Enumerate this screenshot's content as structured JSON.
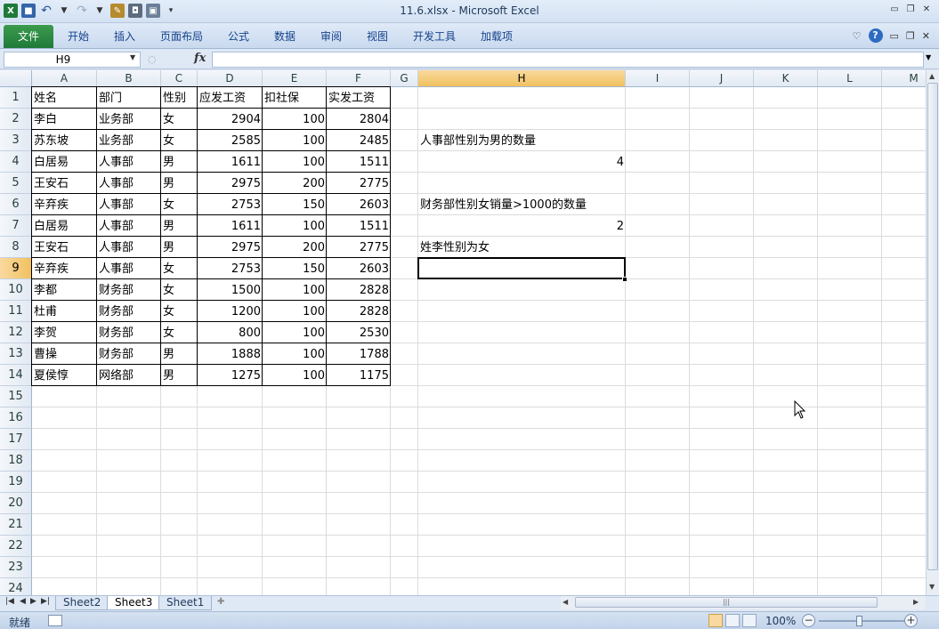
{
  "window": {
    "title": "11.6.xlsx - Microsoft Excel"
  },
  "ribbon": {
    "file_tab": "文件",
    "tabs": [
      "开始",
      "插入",
      "页面布局",
      "公式",
      "数据",
      "审阅",
      "视图",
      "开发工具",
      "加载项"
    ]
  },
  "formula_bar": {
    "name_box": "H9",
    "fx_label": "fx",
    "content": ""
  },
  "grid": {
    "columns": [
      "A",
      "B",
      "C",
      "D",
      "E",
      "F",
      "G",
      "H",
      "I",
      "J",
      "K",
      "L",
      "M"
    ],
    "selected_column": "H",
    "rows": [
      "1",
      "2",
      "3",
      "4",
      "5",
      "6",
      "7",
      "8",
      "9",
      "10",
      "11",
      "12",
      "13",
      "14",
      "15",
      "16",
      "17",
      "18",
      "19",
      "20",
      "21",
      "22",
      "23",
      "24"
    ],
    "selected_row": "9",
    "active_cell": "H9",
    "table": {
      "headers": [
        "姓名",
        "部门",
        "性别",
        "应发工资",
        "扣社保",
        "实发工资"
      ],
      "records": [
        [
          "李白",
          "业务部",
          "女",
          "2904",
          "100",
          "2804"
        ],
        [
          "苏东坡",
          "业务部",
          "女",
          "2585",
          "100",
          "2485"
        ],
        [
          "白居易",
          "人事部",
          "男",
          "1611",
          "100",
          "1511"
        ],
        [
          "王安石",
          "人事部",
          "男",
          "2975",
          "200",
          "2775"
        ],
        [
          "辛弃疾",
          "人事部",
          "女",
          "2753",
          "150",
          "2603"
        ],
        [
          "白居易",
          "人事部",
          "男",
          "1611",
          "100",
          "1511"
        ],
        [
          "王安石",
          "人事部",
          "男",
          "2975",
          "200",
          "2775"
        ],
        [
          "辛弃疾",
          "人事部",
          "女",
          "2753",
          "150",
          "2603"
        ],
        [
          "李都",
          "财务部",
          "女",
          "1500",
          "100",
          "2828"
        ],
        [
          "杜甫",
          "财务部",
          "女",
          "1200",
          "100",
          "2828"
        ],
        [
          "李贺",
          "财务部",
          "女",
          "800",
          "100",
          "2530"
        ],
        [
          "曹操",
          "财务部",
          "男",
          "1888",
          "100",
          "1788"
        ],
        [
          "夏侯惇",
          "网络部",
          "男",
          "1275",
          "100",
          "1175"
        ]
      ]
    },
    "h_column": {
      "h3": "人事部性别为男的数量",
      "h4": "4",
      "h6": "财务部性别女销量>1000的数量",
      "h7": "2",
      "h8": "姓李性别为女"
    }
  },
  "sheets": {
    "tabs": [
      "Sheet2",
      "Sheet3",
      "Sheet1"
    ],
    "active": "Sheet3"
  },
  "status": {
    "ready": "就绪",
    "zoom": "100%"
  },
  "colors": {
    "file_tab": "#1f7a3a",
    "selected_header": "#f1c15f"
  }
}
